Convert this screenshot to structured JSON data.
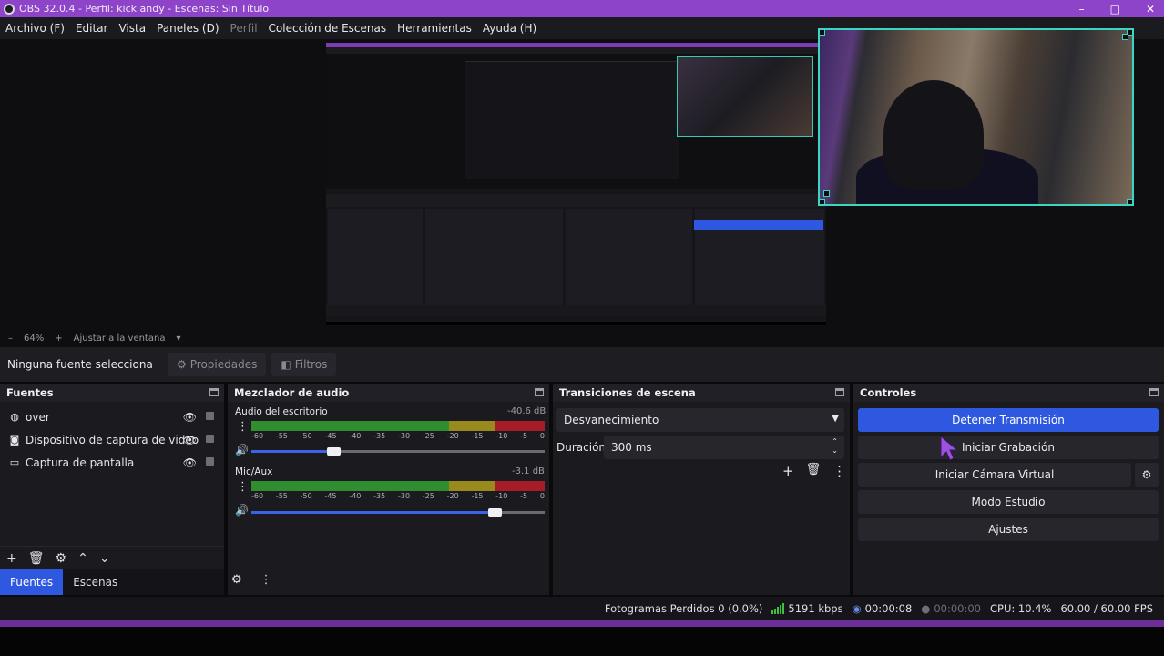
{
  "window": {
    "title": "OBS 32.0.4 - Perfil: kick andy - Escenas: Sin Título",
    "controls": [
      "–",
      "□",
      "✕"
    ]
  },
  "menu": [
    "Archivo (F)",
    "Editar",
    "Vista",
    "Paneles (D)",
    "Perfil",
    "Colección de Escenas",
    "Herramientas",
    "Ayuda (H)"
  ],
  "zoom": {
    "minus": "–",
    "percent": "64%",
    "plus": "+",
    "fit": "Ajustar a la ventana"
  },
  "source_bar": {
    "no_selection": "Ninguna fuente selecciona",
    "properties": "Propiedades",
    "filters": "Filtros"
  },
  "sources": {
    "title": "Fuentes",
    "items": [
      {
        "label": "over",
        "icon": "globe-icon"
      },
      {
        "label": "Dispositivo de captura de video",
        "icon": "camera-icon"
      },
      {
        "label": "Captura de pantalla",
        "icon": "monitor-icon"
      }
    ],
    "tabs": [
      "Fuentes",
      "Escenas"
    ]
  },
  "mixer": {
    "title": "Mezclador de audio",
    "channels": [
      {
        "name": "Audio del escritorio",
        "db": "-40.6 dB",
        "volume": 0.28
      },
      {
        "name": "Mic/Aux",
        "db": "-3.1 dB",
        "volume": 0.83
      }
    ],
    "ticks": [
      "-60",
      "-55",
      "-50",
      "-45",
      "-40",
      "-35",
      "-30",
      "-25",
      "-20",
      "-15",
      "-10",
      "-5",
      "0"
    ]
  },
  "transitions": {
    "title": "Transiciones de escena",
    "selected": "Desvanecimiento",
    "duration_label": "Duración",
    "duration_value": "300 ms"
  },
  "controls": {
    "title": "Controles",
    "buttons": [
      "Detener Transmisión",
      "Iniciar Grabación",
      "Iniciar Cámara Virtual",
      "Modo Estudio",
      "Ajustes"
    ]
  },
  "status": {
    "dropped": "Fotogramas Perdidos 0 (0.0%)",
    "bitrate": "5191 kbps",
    "stream_time": "00:00:08",
    "rec_time": "00:00:00",
    "cpu": "CPU: 10.4%",
    "fps": "60.00 / 60.00 FPS"
  },
  "colors": {
    "accent": "#2f58e0",
    "title_bar": "#8e44c9",
    "selection": "#3ad6c4"
  }
}
